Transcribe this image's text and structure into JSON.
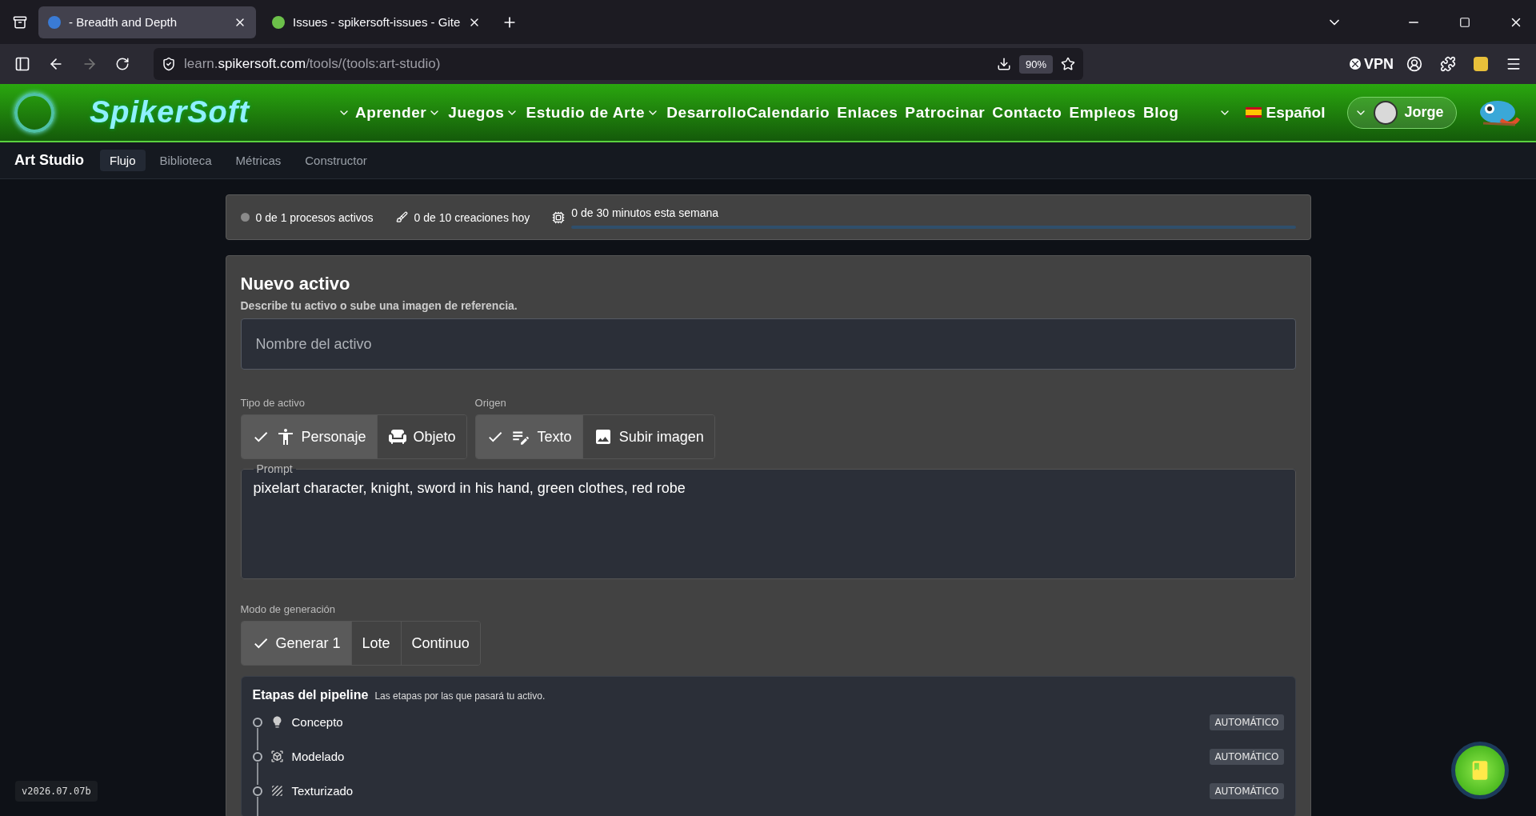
{
  "browser": {
    "tabs": [
      {
        "title": "- Breadth and Depth",
        "selected": true
      },
      {
        "title": "Issues - spikersoft-issues - Gite",
        "selected": false
      }
    ],
    "url": {
      "host": "learn.",
      "domain": "spikersoft.com",
      "path": "/tools/(tools:art-studio)"
    },
    "zoom": "90%",
    "vpn": "VPN"
  },
  "site": {
    "logo": "SpikerSoft",
    "nav": [
      {
        "label": "Aprender",
        "dropdown": true
      },
      {
        "label": "Juegos",
        "dropdown": true
      },
      {
        "label": "Estudio de Arte",
        "dropdown": true
      },
      {
        "label": "Desarrollo",
        "dropdown": false
      },
      {
        "label": "Calendario",
        "dropdown": false
      },
      {
        "label": "Enlaces",
        "dropdown": false
      },
      {
        "label": "Patrocinar",
        "dropdown": false
      },
      {
        "label": "Contacto",
        "dropdown": false
      },
      {
        "label": "Empleos",
        "dropdown": false
      },
      {
        "label": "Blog",
        "dropdown": false
      }
    ],
    "language": "Español",
    "user": "Jorge"
  },
  "subnav": {
    "title": "Art Studio",
    "tabs": [
      {
        "label": "Flujo",
        "selected": true
      },
      {
        "label": "Biblioteca",
        "selected": false
      },
      {
        "label": "Métricas",
        "selected": false
      },
      {
        "label": "Constructor",
        "selected": false
      }
    ]
  },
  "stats": {
    "active": "0 de 1 procesos activos",
    "creations": "0 de 10 creaciones hoy",
    "minutes": "0 de 30 minutos esta semana",
    "level": 0
  },
  "form": {
    "title": "Nuevo activo",
    "subtitle": "Describe tu activo o sube una imagen de referencia.",
    "name_placeholder": "Nombre del activo",
    "asset_type": {
      "label": "Tipo de activo",
      "options": [
        {
          "label": "Personaje",
          "kind": "person",
          "selected": true
        },
        {
          "label": "Objeto",
          "kind": "sofa",
          "selected": false
        }
      ]
    },
    "origin": {
      "label": "Origen",
      "options": [
        {
          "label": "Texto",
          "kind": "text",
          "selected": true
        },
        {
          "label": "Subir imagen",
          "kind": "image",
          "selected": false
        }
      ]
    },
    "prompt": {
      "label": "Prompt",
      "value": "pixelart character, knight, sword in his hand, green clothes, red robe"
    },
    "mode": {
      "label": "Modo de generación",
      "options": [
        {
          "label": "Generar 1",
          "selected": true
        },
        {
          "label": "Lote",
          "selected": false
        },
        {
          "label": "Continuo",
          "selected": false
        }
      ]
    },
    "pipeline": {
      "title": "Etapas del pipeline",
      "subtitle": "Las etapas por las que pasará tu activo.",
      "stages": [
        {
          "name": "Concepto",
          "kind": "bulb",
          "badge": "AUTOMÁTICO"
        },
        {
          "name": "Modelado",
          "kind": "cube",
          "badge": "AUTOMÁTICO"
        },
        {
          "name": "Texturizado",
          "kind": "texture",
          "badge": "AUTOMÁTICO"
        }
      ]
    }
  },
  "version": "v2026.07.07b"
}
